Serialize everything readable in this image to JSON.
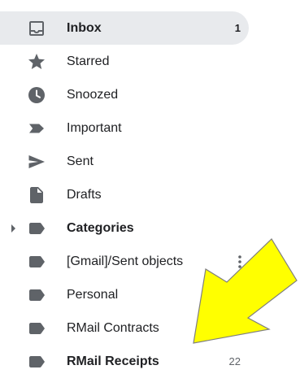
{
  "nav": {
    "items": [
      {
        "label": "Inbox",
        "count": "1",
        "icon": "inbox-icon"
      },
      {
        "label": "Starred",
        "icon": "star-icon"
      },
      {
        "label": "Snoozed",
        "icon": "clock-icon"
      },
      {
        "label": "Important",
        "icon": "important-icon"
      },
      {
        "label": "Sent",
        "icon": "send-icon"
      },
      {
        "label": "Drafts",
        "icon": "draft-icon"
      },
      {
        "label": "Categories",
        "icon": "label-icon"
      },
      {
        "label": "[Gmail]/Sent objects",
        "icon": "label-icon"
      },
      {
        "label": "Personal",
        "icon": "label-icon"
      },
      {
        "label": "RMail Contracts",
        "icon": "label-icon"
      },
      {
        "label": "RMail Receipts",
        "count": "22",
        "icon": "label-icon"
      }
    ]
  },
  "colors": {
    "icon": "#5f6368",
    "text": "#202124",
    "highlight": "#e8eaed",
    "annotation_fill": "#ffff00",
    "annotation_stroke": "#7f7f7f"
  }
}
